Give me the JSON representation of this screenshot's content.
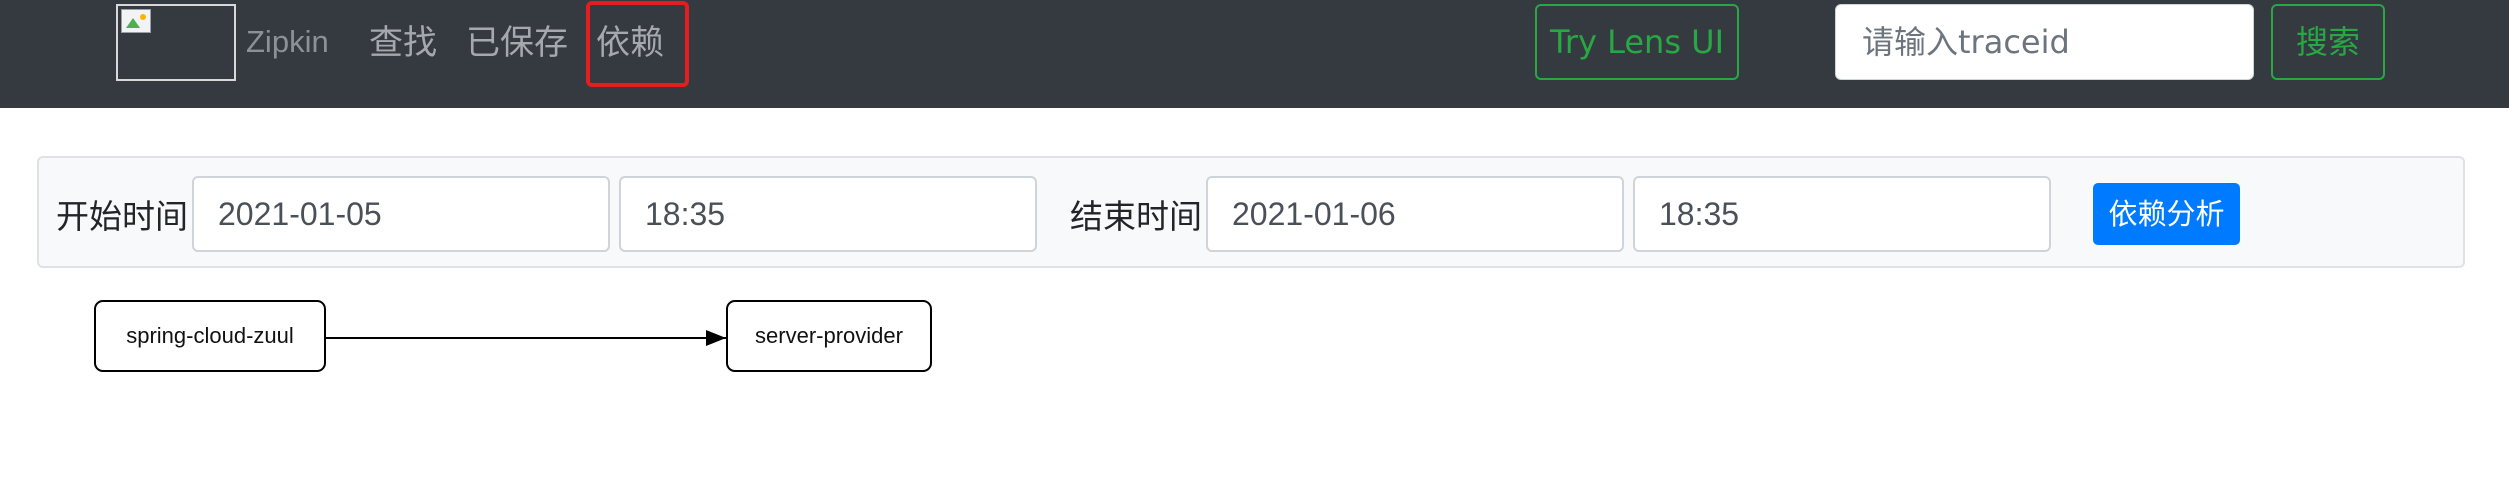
{
  "navbar": {
    "brand_text": "Zipkin",
    "links": [
      {
        "label": "查找"
      },
      {
        "label": "已保存"
      },
      {
        "label": "依赖"
      }
    ],
    "active_link": "依赖",
    "lens_button_label": "Try Lens UI",
    "traceid_placeholder": "请输入traceid",
    "search_button_label": "搜索",
    "colors": {
      "background": "#343a40",
      "success": "#28a745",
      "highlight": "#e41e1e"
    }
  },
  "filter": {
    "start_label": "开始时间",
    "start_date": "2021-01-05",
    "start_time": "18:35",
    "end_label": "结束时间",
    "end_date": "2021-01-06",
    "end_time": "18:35",
    "analyze_button_label": "依赖分析",
    "colors": {
      "primary": "#007bff"
    }
  },
  "graph": {
    "nodes": [
      {
        "name": "spring-cloud-zuul"
      },
      {
        "name": "server-provider"
      }
    ],
    "edges": [
      {
        "from": "spring-cloud-zuul",
        "to": "server-provider"
      }
    ]
  }
}
